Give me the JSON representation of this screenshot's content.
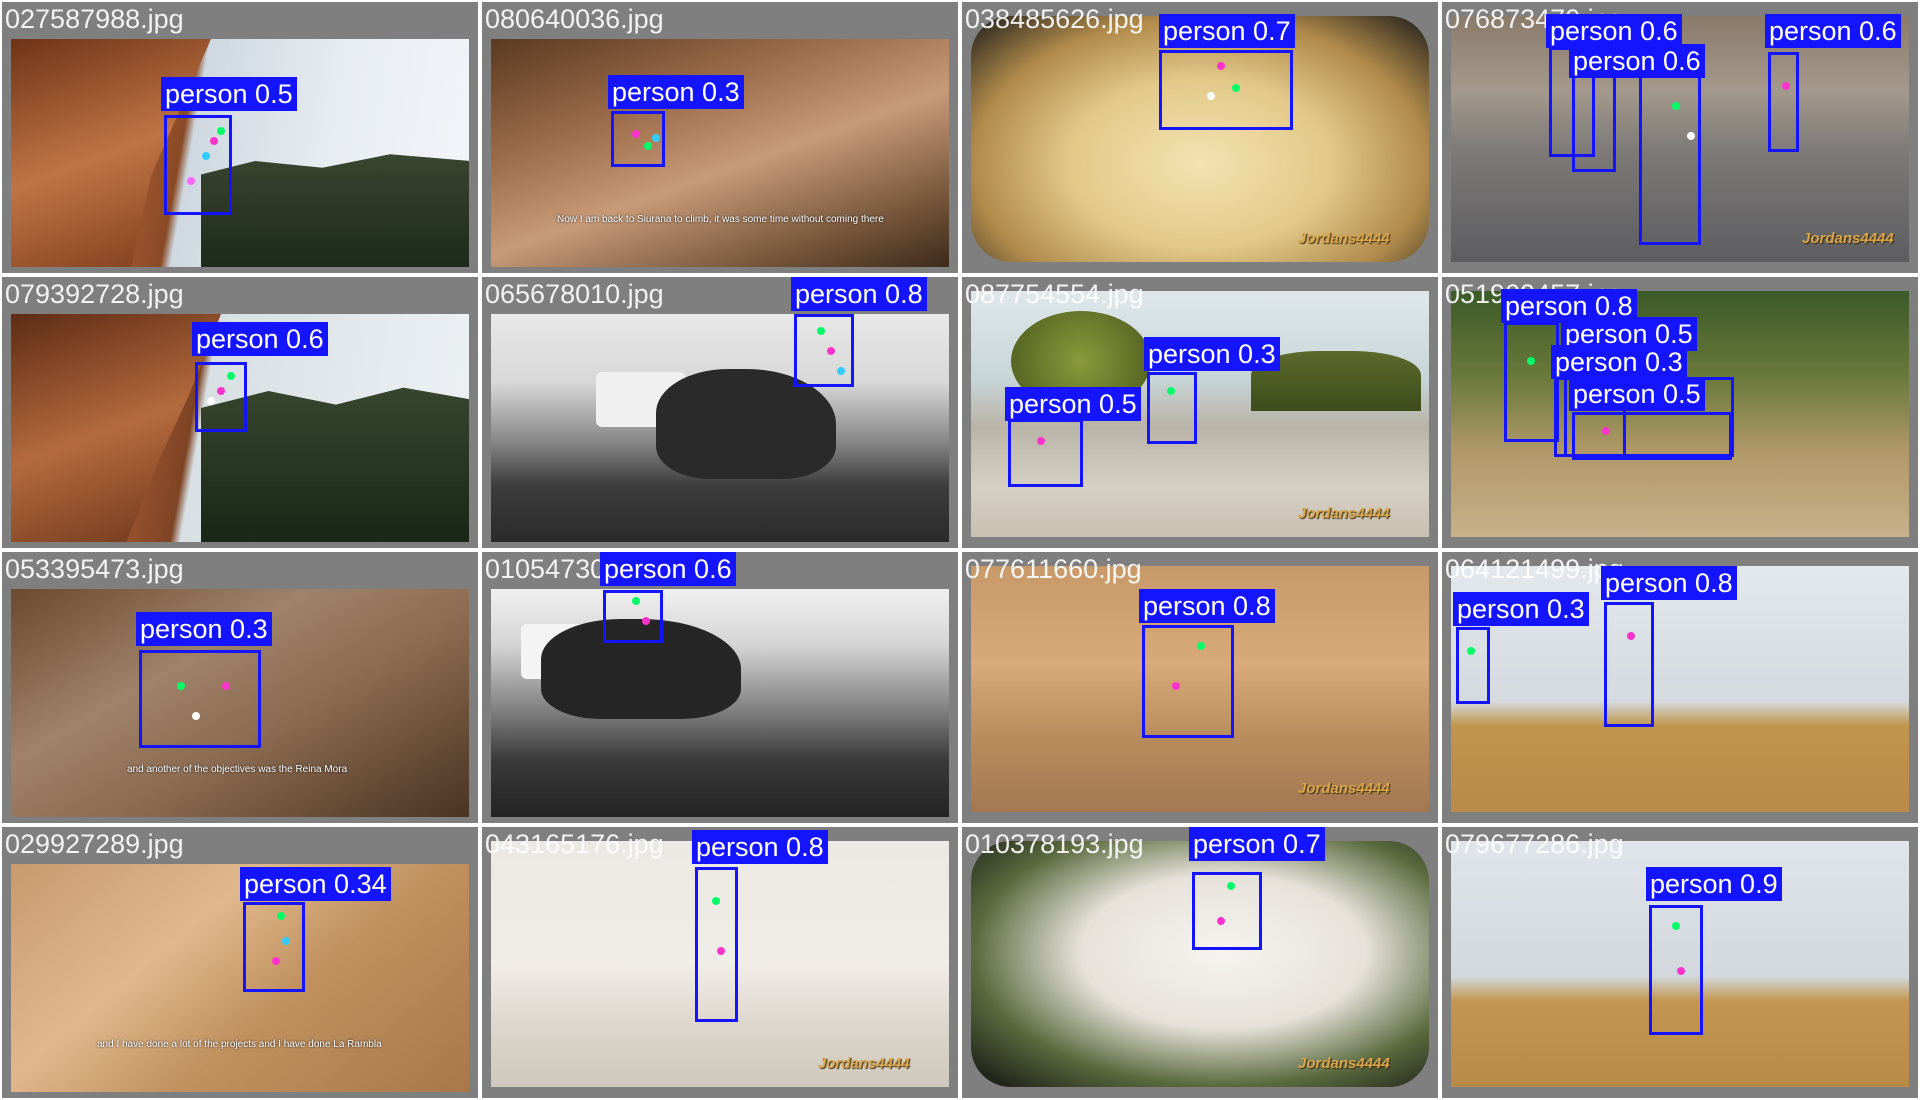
{
  "cells": [
    {
      "filename": "027587988.jpg",
      "label": "person 0.5"
    },
    {
      "filename": "080640036.jpg",
      "label": "person 0.3",
      "caption": "Now I am back to Siurana to climb, it was some time without coming there"
    },
    {
      "filename": "038485626.jpg",
      "label": "person 0.7",
      "watermark": "Jordans4444"
    },
    {
      "filename": "076873470.jpg",
      "labels": [
        "person 0.6",
        "person 0.6",
        "person 0.6"
      ],
      "watermark": "Jordans4444"
    },
    {
      "filename": "079392728.jpg",
      "label": "person 0.6"
    },
    {
      "filename": "065678010.jpg",
      "label": "person 0.8"
    },
    {
      "filename": "087754554.jpg",
      "labels": [
        "person 0.3",
        "person 0.5"
      ],
      "watermark": "Jordans4444"
    },
    {
      "filename": "051909457.jpg",
      "labels": [
        "person 0.8",
        "person 0.5",
        "person 0.3",
        "person 0.5"
      ]
    },
    {
      "filename": "053395473.jpg",
      "label": "person 0.3",
      "caption": "and another of the objectives was the Reina Mora"
    },
    {
      "filename": "010547300.jpg",
      "label": "person 0.6"
    },
    {
      "filename": "077611660.jpg",
      "label": "person 0.8",
      "watermark": "Jordans4444"
    },
    {
      "filename": "064121499.jpg",
      "labels": [
        "person 0.3",
        "person 0.8"
      ]
    },
    {
      "filename": "029927289.jpg",
      "label": "person 0.34",
      "caption": "and I have done a lot of the projects and I have done La Rambla"
    },
    {
      "filename": "043165176.jpg",
      "label": "person 0.8",
      "watermark": "Jordans4444"
    },
    {
      "filename": "010378193.jpg",
      "label": "person 0.7",
      "watermark": "Jordans4444"
    },
    {
      "filename": "079677286.jpg",
      "label": "person 0.9"
    }
  ],
  "colors": {
    "box": "#1414ff",
    "tile_bg": "#7f7f7f"
  }
}
